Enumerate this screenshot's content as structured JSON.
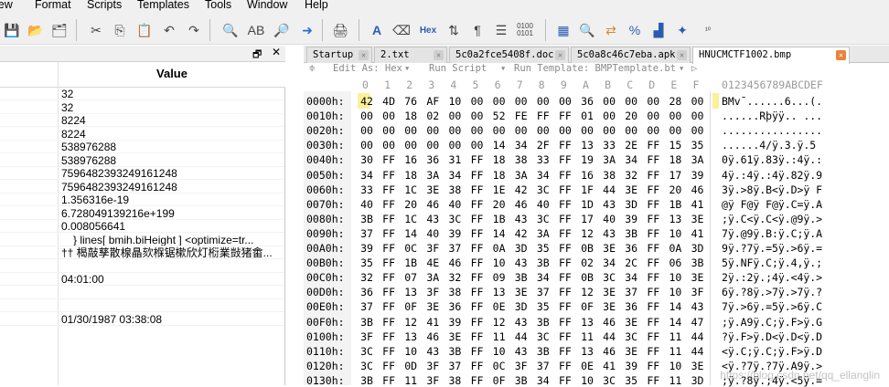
{
  "menu": [
    "iew",
    "Format",
    "Scripts",
    "Templates",
    "Tools",
    "Window",
    "Help"
  ],
  "left_panel": {
    "column_header": "Value",
    "values": [
      "32",
      "32",
      "8224",
      "8224",
      "538976288",
      "538976288",
      "7596482393249161248",
      "7596482393249161248",
      "1.356316e-19",
      "6.728049139216e+199",
      "0.008056641",
      "} lines[ bmih.biHeight ] <optimize=tr...",
      "†† 楬敲孳散楾瞐欬椺锯樕欣灯椼業敱猪畬...",
      "",
      "04:01:00",
      "",
      "",
      "01/30/1987 03:38:08"
    ]
  },
  "tabs": [
    {
      "label": "Startup",
      "active": false
    },
    {
      "label": "2.txt",
      "active": false
    },
    {
      "label": "5c0a2fce5408f.doc",
      "active": false
    },
    {
      "label": "5c0a8c46c7eba.apk",
      "active": false
    },
    {
      "label": "HNUCMCTF1002.bmp",
      "active": true
    }
  ],
  "editbar": {
    "edit_as": "Edit As: Hex",
    "run_script": "Run Script",
    "run_template": "Run Template: BMPTemplate.bt"
  },
  "hex_header": {
    "cols": [
      "0",
      "1",
      "2",
      "3",
      "4",
      "5",
      "6",
      "7",
      "8",
      "9",
      "A",
      "B",
      "C",
      "D",
      "E",
      "F"
    ],
    "ascii_header": "0123456789ABCDEF"
  },
  "rows": [
    {
      "addr": "0000h:",
      "bytes": [
        "42",
        "4D",
        "76",
        "AF",
        "10",
        "00",
        "00",
        "00",
        "00",
        "00",
        "36",
        "00",
        "00",
        "00",
        "28",
        "00"
      ],
      "ascii": "BMv¯......6...(."
    },
    {
      "addr": "0010h:",
      "bytes": [
        "00",
        "00",
        "18",
        "02",
        "00",
        "00",
        "52",
        "FE",
        "FF",
        "FF",
        "01",
        "00",
        "20",
        "00",
        "00",
        "00"
      ],
      "ascii": "......Rþÿÿ.. ..."
    },
    {
      "addr": "0020h:",
      "bytes": [
        "00",
        "00",
        "00",
        "00",
        "00",
        "00",
        "00",
        "00",
        "00",
        "00",
        "00",
        "00",
        "00",
        "00",
        "00",
        "00"
      ],
      "ascii": "................"
    },
    {
      "addr": "0030h:",
      "bytes": [
        "00",
        "00",
        "00",
        "00",
        "00",
        "00",
        "14",
        "34",
        "2F",
        "FF",
        "13",
        "33",
        "2E",
        "FF",
        "15",
        "35"
      ],
      "ascii": "......4/ÿ.3.ÿ.5"
    },
    {
      "addr": "0040h:",
      "bytes": [
        "30",
        "FF",
        "16",
        "36",
        "31",
        "FF",
        "18",
        "38",
        "33",
        "FF",
        "19",
        "3A",
        "34",
        "FF",
        "18",
        "3A"
      ],
      "ascii": "0ÿ.61ÿ.83ÿ.:4ÿ.:"
    },
    {
      "addr": "0050h:",
      "bytes": [
        "34",
        "FF",
        "18",
        "3A",
        "34",
        "FF",
        "18",
        "3A",
        "34",
        "FF",
        "16",
        "38",
        "32",
        "FF",
        "17",
        "39"
      ],
      "ascii": "4ÿ.:4ÿ.:4ÿ.82ÿ.9"
    },
    {
      "addr": "0060h:",
      "bytes": [
        "33",
        "FF",
        "1C",
        "3E",
        "38",
        "FF",
        "1E",
        "42",
        "3C",
        "FF",
        "1F",
        "44",
        "3E",
        "FF",
        "20",
        "46"
      ],
      "ascii": "3ÿ.>8ÿ.B<ÿ.D>ÿ F"
    },
    {
      "addr": "0070h:",
      "bytes": [
        "40",
        "FF",
        "20",
        "46",
        "40",
        "FF",
        "20",
        "46",
        "40",
        "FF",
        "1D",
        "43",
        "3D",
        "FF",
        "1B",
        "41"
      ],
      "ascii": "@ÿ F@ÿ F@ÿ.C=ÿ.A"
    },
    {
      "addr": "0080h:",
      "bytes": [
        "3B",
        "FF",
        "1C",
        "43",
        "3C",
        "FF",
        "1B",
        "43",
        "3C",
        "FF",
        "17",
        "40",
        "39",
        "FF",
        "13",
        "3E"
      ],
      "ascii": ";ÿ.C<ÿ.C<ÿ.@9ÿ.>"
    },
    {
      "addr": "0090h:",
      "bytes": [
        "37",
        "FF",
        "14",
        "40",
        "39",
        "FF",
        "14",
        "42",
        "3A",
        "FF",
        "12",
        "43",
        "3B",
        "FF",
        "10",
        "41"
      ],
      "ascii": "7ÿ.@9ÿ.B:ÿ.C;ÿ.A"
    },
    {
      "addr": "00A0h:",
      "bytes": [
        "39",
        "FF",
        "0C",
        "3F",
        "37",
        "FF",
        "0A",
        "3D",
        "35",
        "FF",
        "0B",
        "3E",
        "36",
        "FF",
        "0A",
        "3D"
      ],
      "ascii": "9ÿ.?7ÿ.=5ÿ.>6ÿ.="
    },
    {
      "addr": "00B0h:",
      "bytes": [
        "35",
        "FF",
        "1B",
        "4E",
        "46",
        "FF",
        "10",
        "43",
        "3B",
        "FF",
        "02",
        "34",
        "2C",
        "FF",
        "06",
        "3B"
      ],
      "ascii": "5ÿ.NFÿ.C;ÿ.4,ÿ.;"
    },
    {
      "addr": "00C0h:",
      "bytes": [
        "32",
        "FF",
        "07",
        "3A",
        "32",
        "FF",
        "09",
        "3B",
        "34",
        "FF",
        "0B",
        "3C",
        "34",
        "FF",
        "10",
        "3E"
      ],
      "ascii": "2ÿ.:2ÿ.;4ÿ.<4ÿ.>"
    },
    {
      "addr": "00D0h:",
      "bytes": [
        "36",
        "FF",
        "13",
        "3F",
        "38",
        "FF",
        "13",
        "3E",
        "37",
        "FF",
        "12",
        "3E",
        "37",
        "FF",
        "10",
        "3F"
      ],
      "ascii": "6ÿ.?8ÿ.>7ÿ.>7ÿ.?"
    },
    {
      "addr": "00E0h:",
      "bytes": [
        "37",
        "FF",
        "0F",
        "3E",
        "36",
        "FF",
        "0E",
        "3D",
        "35",
        "FF",
        "0F",
        "3E",
        "36",
        "FF",
        "14",
        "43"
      ],
      "ascii": "7ÿ.>6ÿ.=5ÿ.>6ÿ.C"
    },
    {
      "addr": "00F0h:",
      "bytes": [
        "3B",
        "FF",
        "12",
        "41",
        "39",
        "FF",
        "12",
        "43",
        "3B",
        "FF",
        "13",
        "46",
        "3E",
        "FF",
        "14",
        "47"
      ],
      "ascii": ";ÿ.A9ÿ.C;ÿ.F>ÿ.G"
    },
    {
      "addr": "0100h:",
      "bytes": [
        "3F",
        "FF",
        "13",
        "46",
        "3E",
        "FF",
        "11",
        "44",
        "3C",
        "FF",
        "11",
        "44",
        "3C",
        "FF",
        "11",
        "44"
      ],
      "ascii": "?ÿ.F>ÿ.D<ÿ.D<ÿ.D"
    },
    {
      "addr": "0110h:",
      "bytes": [
        "3C",
        "FF",
        "10",
        "43",
        "3B",
        "FF",
        "10",
        "43",
        "3B",
        "FF",
        "13",
        "46",
        "3E",
        "FF",
        "11",
        "44"
      ],
      "ascii": "<ÿ.C;ÿ.C;ÿ.F>ÿ.D"
    },
    {
      "addr": "0120h:",
      "bytes": [
        "3C",
        "FF",
        "0D",
        "3F",
        "37",
        "FF",
        "0C",
        "3F",
        "37",
        "FF",
        "0E",
        "41",
        "39",
        "FF",
        "10",
        "3E"
      ],
      "ascii": "<ÿ.?7ÿ.?7ÿ.A9ÿ.>"
    },
    {
      "addr": "0130h:",
      "bytes": [
        "3B",
        "FF",
        "11",
        "3F",
        "38",
        "FF",
        "0F",
        "3B",
        "34",
        "FF",
        "10",
        "3C",
        "35",
        "FF",
        "11",
        "3D"
      ],
      "ascii": ";ÿ.?8ÿ.;4ÿ.<5ÿ.="
    }
  ],
  "watermark": "https://blog.csdn.net/qq_ellanglin"
}
